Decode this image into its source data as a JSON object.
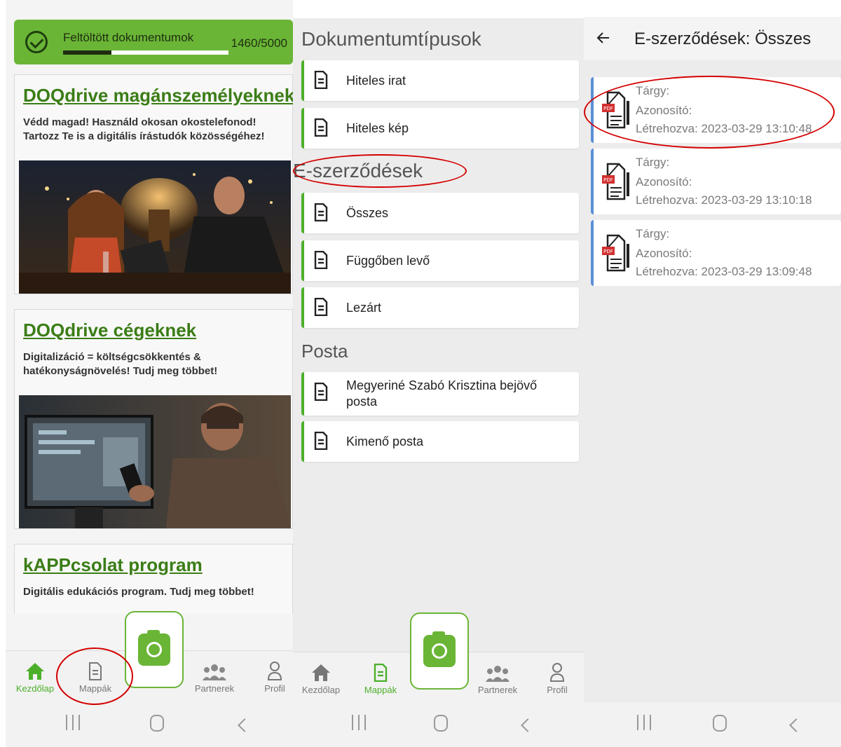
{
  "panel1": {
    "upload": {
      "label": "Feltöltött dokumentumok",
      "count": "1460/5000",
      "progress_fraction": 0.292
    },
    "promos": [
      {
        "title": "DOQdrive magánszemélyeknek",
        "desc": "Védd magad! Használd okosan okostelefonod! Tartozz Te is a digitális írástudók közösségéhez!"
      },
      {
        "title": "DOQdrive cégeknek",
        "desc": "Digitalizáció = költségcsökkentés & hatékonyságnövelés! Tudj meg többet!"
      },
      {
        "title": "kAPPcsolat program",
        "desc": "Digitális edukációs program. Tudj meg többet!"
      }
    ],
    "nav": {
      "home": "Kezdőlap",
      "folders": "Mappák",
      "partners": "Partnerek",
      "profile": "Profil"
    }
  },
  "panel2": {
    "sections": [
      {
        "title": "Dokumentumtípusok",
        "items": [
          "Hiteles irat",
          "Hiteles kép"
        ]
      },
      {
        "title": "E-szerződések",
        "items": [
          "Összes",
          "Függőben levő",
          "Lezárt"
        ]
      },
      {
        "title": "Posta",
        "items": [
          "Megyeriné Szabó Krisztina bejövő posta",
          "Kimenő posta"
        ]
      }
    ],
    "nav": {
      "home": "Kezdőlap",
      "folders": "Mappák",
      "partners": "Partnerek",
      "profile": "Profil"
    }
  },
  "panel3": {
    "title": "E-szerződések: Összes",
    "contracts": [
      {
        "subject": "Tárgy:",
        "id": "Azonosító:",
        "created": "Létrehozva: 2023-03-29 13:10:48"
      },
      {
        "subject": "Tárgy:",
        "id": "Azonosító:",
        "created": "Létrehozva: 2023-03-29 13:10:18"
      },
      {
        "subject": "Tárgy:",
        "id": "Azonosító:",
        "created": "Létrehozva: 2023-03-29 13:09:48"
      }
    ]
  },
  "icons": {
    "check": "check-circle-icon",
    "home": "home-icon",
    "folder": "document-icon",
    "partners": "people-icon",
    "profile": "user-icon",
    "camera": "camera-icon",
    "pdf": "pdf-file-icon",
    "back": "arrow-left-icon"
  },
  "colors": {
    "accent": "#6ab536",
    "active_nav": "#4caf2a",
    "title_green": "#3b7d16",
    "contract_border": "#5b8fd6",
    "annotation": "#d40000"
  }
}
